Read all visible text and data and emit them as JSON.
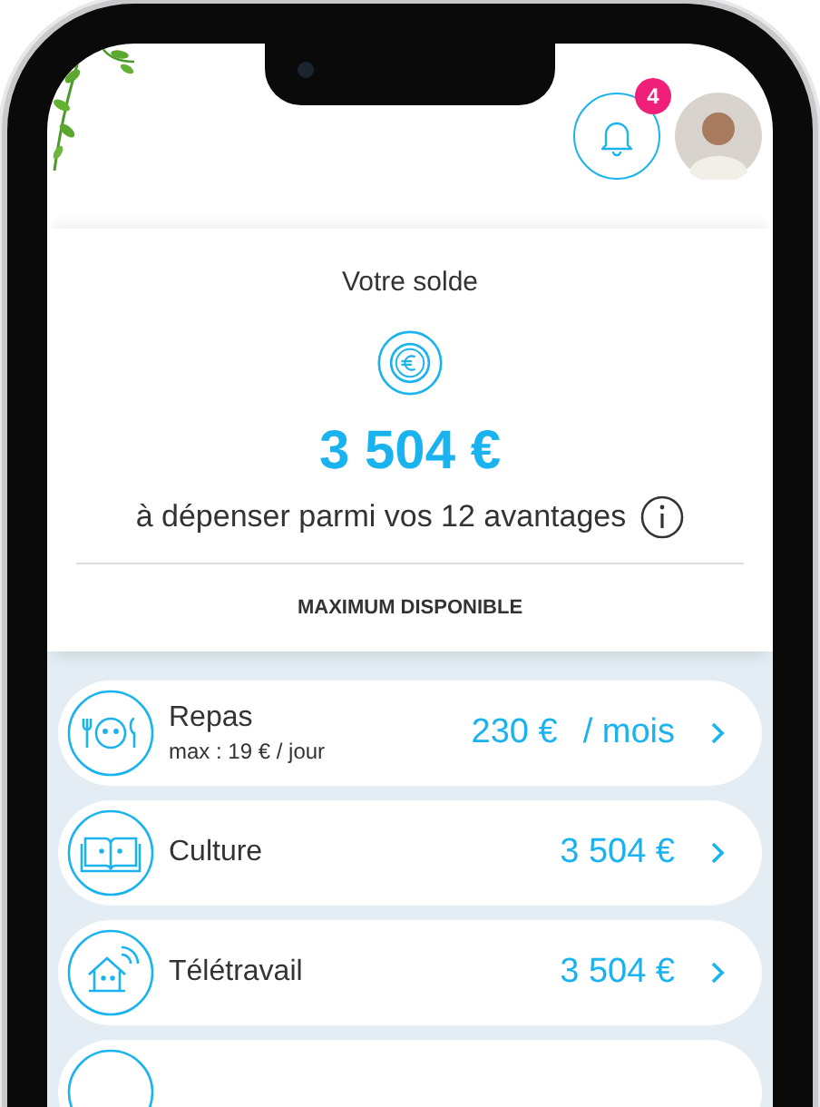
{
  "header": {
    "notification_count": "4"
  },
  "balance": {
    "label": "Votre solde",
    "amount": "3 504 €",
    "subtitle": "à dépenser parmi vos 12 avantages",
    "section": "MAXIMUM DISPONIBLE"
  },
  "benefits": [
    {
      "kind": "meal",
      "name": "Repas",
      "detail": "max : 19 € / jour",
      "amount": "230 €",
      "unit": "/ mois"
    },
    {
      "kind": "book",
      "name": "Culture",
      "amount": "3 504 €"
    },
    {
      "kind": "house",
      "name": "Télétravail",
      "amount": "3 504 €"
    }
  ]
}
